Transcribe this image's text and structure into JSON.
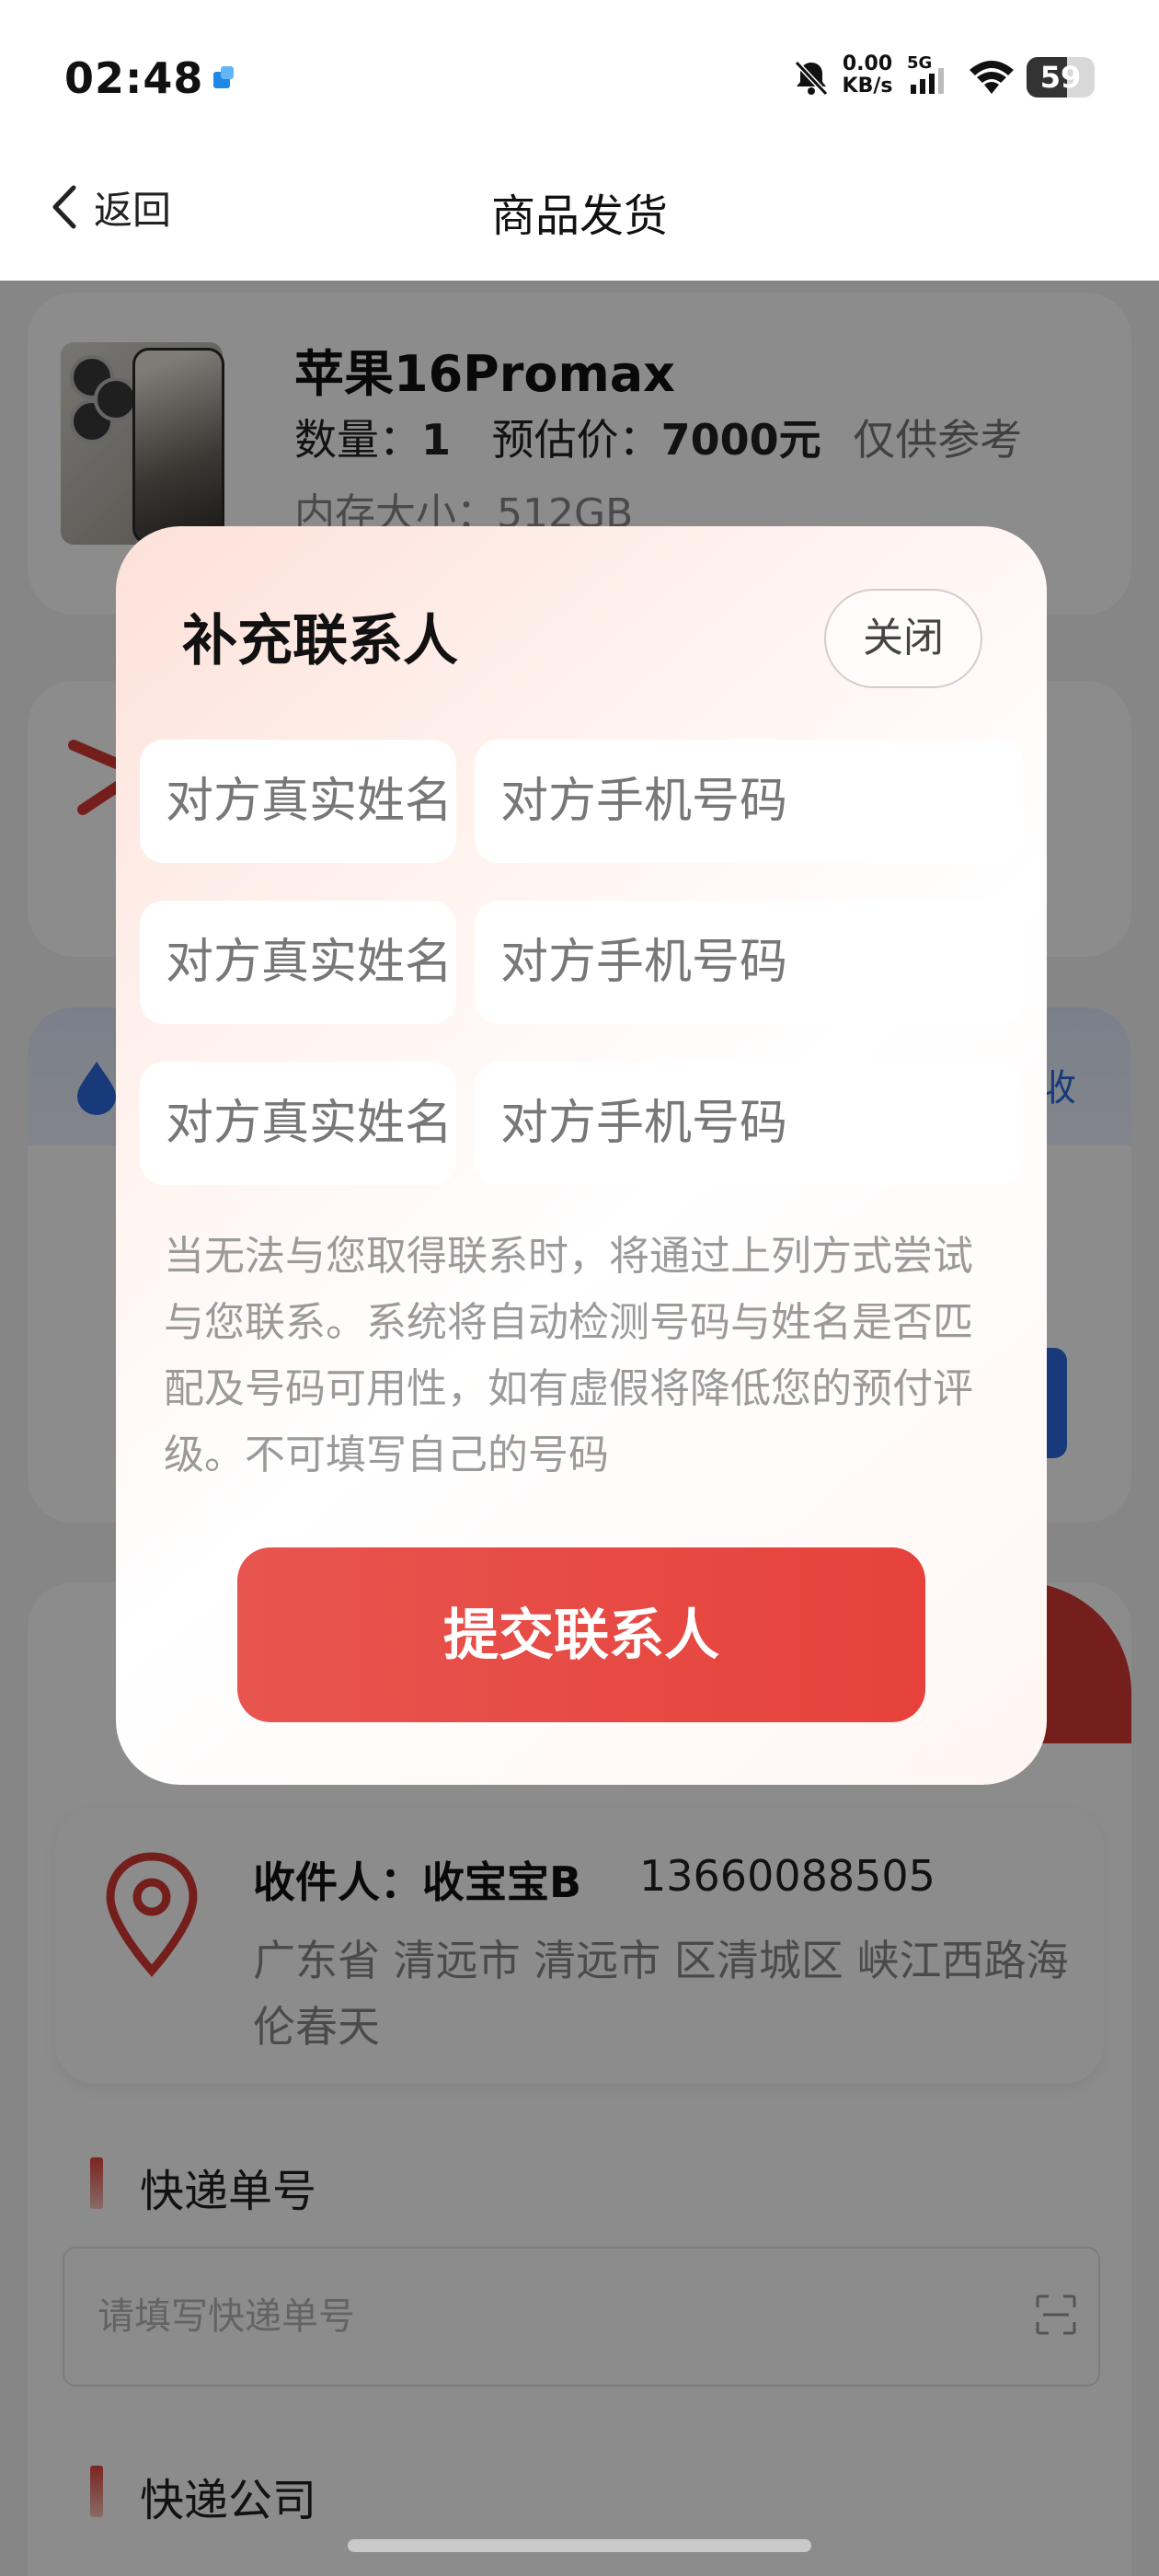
{
  "status_bar": {
    "time": "02:48",
    "net_speed_value": "0.00",
    "net_speed_unit": "KB/s",
    "network": "5G",
    "battery": "59",
    "battery_level": 0.59
  },
  "nav": {
    "back_label": "返回",
    "title": "商品发货"
  },
  "product": {
    "name": "苹果16Promax",
    "quantity_label": "数量：",
    "quantity": "1",
    "price_label": "预估价：",
    "price": "7000元",
    "price_note": "仅供参考",
    "storage": "内存大小：512GB"
  },
  "background": {
    "recycle_link": "回收",
    "partial_text_1": "",
    "partial_text_2": "",
    "partial_text_3": ""
  },
  "receiver": {
    "name": "收件人：收宝宝B",
    "phone": "13660088505",
    "address": "广东省 清远市 清远市 区清城区 峡江西路海伦春天"
  },
  "shipping": {
    "tracking_label": "快递单号",
    "tracking_placeholder": "请填写快递单号",
    "company_label": "快递公司"
  },
  "modal": {
    "title": "补充联系人",
    "close_label": "关闭",
    "contacts": [
      {
        "name_placeholder": "对方真实姓名",
        "phone_placeholder": "对方手机号码"
      },
      {
        "name_placeholder": "对方真实姓名",
        "phone_placeholder": "对方手机号码"
      },
      {
        "name_placeholder": "对方真实姓名",
        "phone_placeholder": "对方手机号码"
      }
    ],
    "note": "当无法与您取得联系时，将通过上列方式尝试与您联系。系统将自动检测号码与姓名是否匹配及号码可用性，如有虚假将降低您的预付评级。不可填写自己的号码",
    "submit_label": "提交联系人"
  },
  "colors": {
    "accent_red": "#e6423b",
    "link_blue": "#2d6be0"
  }
}
